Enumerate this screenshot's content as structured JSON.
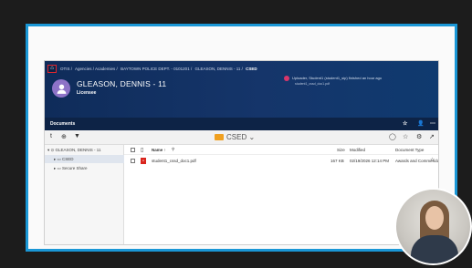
{
  "breadcrumb": [
    "OTIS /",
    "Agencies / Academies /",
    "BAYTOWN POLICE DEPT. - 0101201 /",
    "GLEASON, DENNIS - 11 /",
    "CSED"
  ],
  "profile": {
    "name": "GLEASON, DENNIS - 11",
    "role": "Licensee"
  },
  "upload": {
    "message": "Uploader, Student1 (student1_sip) finished an hour ago",
    "file": "student1_cssd_doc1.pdf"
  },
  "docs_bar": {
    "title": "Documents"
  },
  "toolbar": {
    "folder": "CSED",
    "folder_caret": "⌄"
  },
  "tree": {
    "root": "GLEASON, DENNIS - 11",
    "items": [
      {
        "label": "CSED",
        "selected": true
      },
      {
        "label": "Secure Share",
        "selected": false
      }
    ]
  },
  "table": {
    "headers": {
      "name": "Name ↑",
      "size": "Size",
      "modified": "Modified",
      "type": "Document Type"
    },
    "rows": [
      {
        "name": "student1_cssd_doc1.pdf",
        "size": "167 KB",
        "modified": "02/19/2026 12:14 PM",
        "type": "Awards and Commendations"
      }
    ]
  },
  "icons": [
    "home-icon",
    "user-icon",
    "star-icon",
    "person-icon",
    "more-icon",
    "tag-icon",
    "upload-icon",
    "filter-icon",
    "search-icon",
    "comment-icon",
    "gear-icon",
    "open-icon",
    "folder-icon",
    "pdf-icon"
  ],
  "colors": {
    "frame": "#1a97d6",
    "header": "#0f2c5a",
    "folder": "#f0a020",
    "pdf": "#d9251d",
    "avatar": "#8e73c7"
  }
}
